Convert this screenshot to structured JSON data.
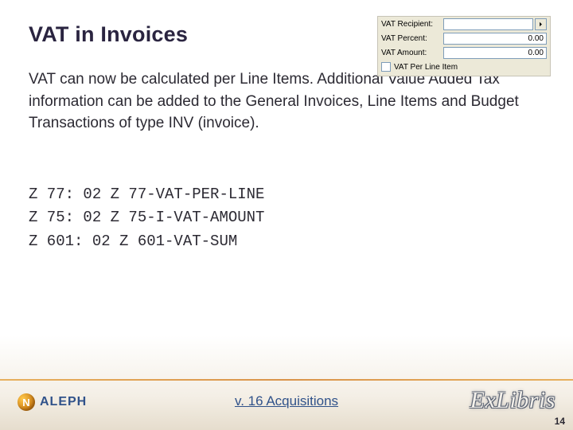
{
  "title": "VAT in Invoices",
  "body": "VAT can now be calculated per Line Items. Additional Value Added Tax information can be added to the General Invoices, Line Items and Budget Transactions of type INV (invoice).",
  "config": {
    "line1": "Z 77: 02 Z 77-VAT-PER-LINE",
    "line2": "Z 75: 02 Z 75-I-VAT-AMOUNT",
    "line3": "Z 601: 02 Z 601-VAT-SUM"
  },
  "form": {
    "recipient_label": "VAT Recipient:",
    "recipient_value": "",
    "percent_label": "VAT Percent:",
    "percent_value": "0.00",
    "amount_label": "VAT Amount:",
    "amount_value": "0.00",
    "perline_label": "VAT Per Line Item"
  },
  "footer": {
    "caption": "v. 16 Acquisitions",
    "aleph": "ALEPH",
    "aleph_mark": "N",
    "exlibris": "ExLibris",
    "page": "14"
  }
}
